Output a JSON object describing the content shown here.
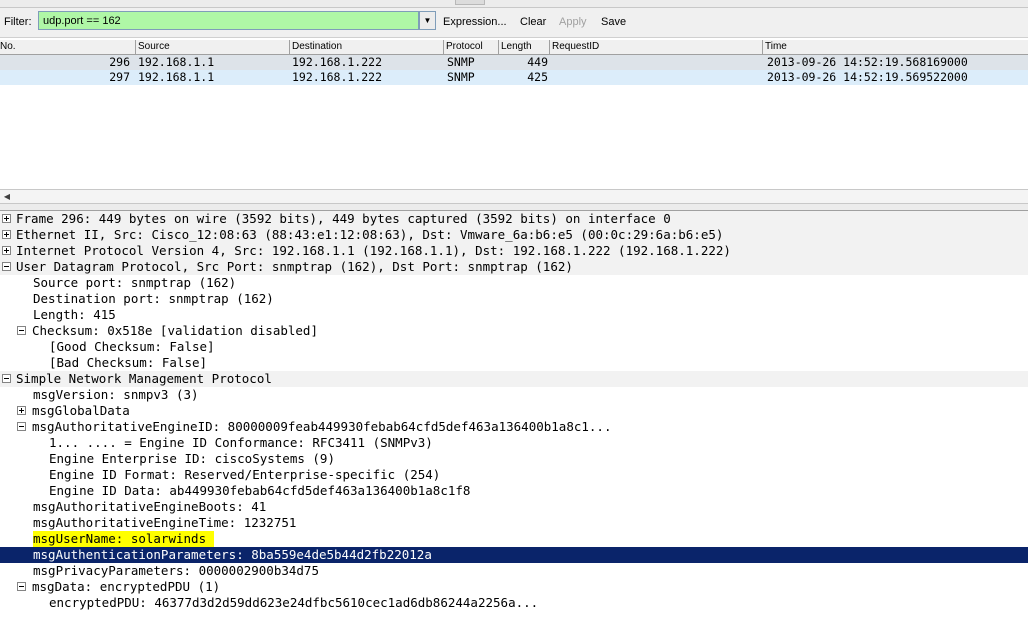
{
  "filter": {
    "label": "Filter:",
    "value": "udp.port == 162",
    "expression_label": "Expression...",
    "clear_label": "Clear",
    "apply_label": "Apply",
    "save_label": "Save",
    "dropdown_icon": "chevron-down-icon",
    "input_color": "#aff7a6"
  },
  "packet_list": {
    "columns": [
      "No.",
      "Source",
      "Destination",
      "Protocol",
      "Length",
      "RequestID",
      "Time"
    ],
    "rows": [
      {
        "no": "296",
        "source": "192.168.1.1",
        "destination": "192.168.1.222",
        "protocol": "SNMP",
        "length": "449",
        "requestid": "",
        "time": "2013-09-26 14:52:19.568169000"
      },
      {
        "no": "297",
        "source": "192.168.1.1",
        "destination": "192.168.1.222",
        "protocol": "SNMP",
        "length": "425",
        "requestid": "",
        "time": "2013-09-26 14:52:19.569522000"
      }
    ]
  },
  "details": [
    {
      "text": "Frame 296: 449 bytes on wire (3592 bits), 449 bytes captured (3592 bits) on interface 0",
      "expander": "plus"
    },
    {
      "text": "Ethernet II, Src: Cisco_12:08:63 (88:43:e1:12:08:63), Dst: Vmware_6a:b6:e5 (00:0c:29:6a:b6:e5)",
      "expander": "plus"
    },
    {
      "text": "Internet Protocol Version 4, Src: 192.168.1.1 (192.168.1.1), Dst: 192.168.1.222 (192.168.1.222)",
      "expander": "plus"
    },
    {
      "text": "User Datagram Protocol, Src Port: snmptrap (162), Dst Port: snmptrap (162)",
      "expander": "minus"
    },
    {
      "text": "Source port: snmptrap (162)",
      "expander": "none"
    },
    {
      "text": "Destination port: snmptrap (162)",
      "expander": "none"
    },
    {
      "text": "Length: 415",
      "expander": "none"
    },
    {
      "text": "Checksum: 0x518e [validation disabled]",
      "expander": "minus"
    },
    {
      "text": "[Good Checksum: False]",
      "expander": "none"
    },
    {
      "text": "[Bad Checksum: False]",
      "expander": "none"
    },
    {
      "text": "Simple Network Management Protocol",
      "expander": "minus"
    },
    {
      "text": "msgVersion: snmpv3 (3)",
      "expander": "none"
    },
    {
      "text": "msgGlobalData",
      "expander": "plus"
    },
    {
      "text": "msgAuthoritativeEngineID: 80000009feab449930febab64cfd5def463a136400b1a8c1...",
      "expander": "minus"
    },
    {
      "text": "1... .... = Engine ID Conformance: RFC3411 (SNMPv3)",
      "expander": "none"
    },
    {
      "text": "Engine Enterprise ID: ciscoSystems (9)",
      "expander": "none"
    },
    {
      "text": "Engine ID Format: Reserved/Enterprise-specific (254)",
      "expander": "none"
    },
    {
      "text": "Engine ID Data: ab449930febab64cfd5def463a136400b1a8c1f8",
      "expander": "none"
    },
    {
      "text": "msgAuthoritativeEngineBoots: 41",
      "expander": "none"
    },
    {
      "text": "msgAuthoritativeEngineTime: 1232751",
      "expander": "none"
    },
    {
      "text": "msgUserName: solarwinds",
      "expander": "none"
    },
    {
      "text": "msgAuthenticationParameters: 8ba559e4de5b44d2fb22012a",
      "expander": "none"
    },
    {
      "text": "msgPrivacyParameters: 0000002900b34d75",
      "expander": "none"
    },
    {
      "text": "msgData: encryptedPDU (1)",
      "expander": "minus"
    },
    {
      "text": "encryptedPDU: 46377d3d2d59dd623e24dfbc5610cec1ad6db86244a2256a...",
      "expander": "none"
    }
  ],
  "colors": {
    "selected_row": "#0a246a",
    "highlight": "#ffff00",
    "alt_row": "#dcedfa"
  }
}
